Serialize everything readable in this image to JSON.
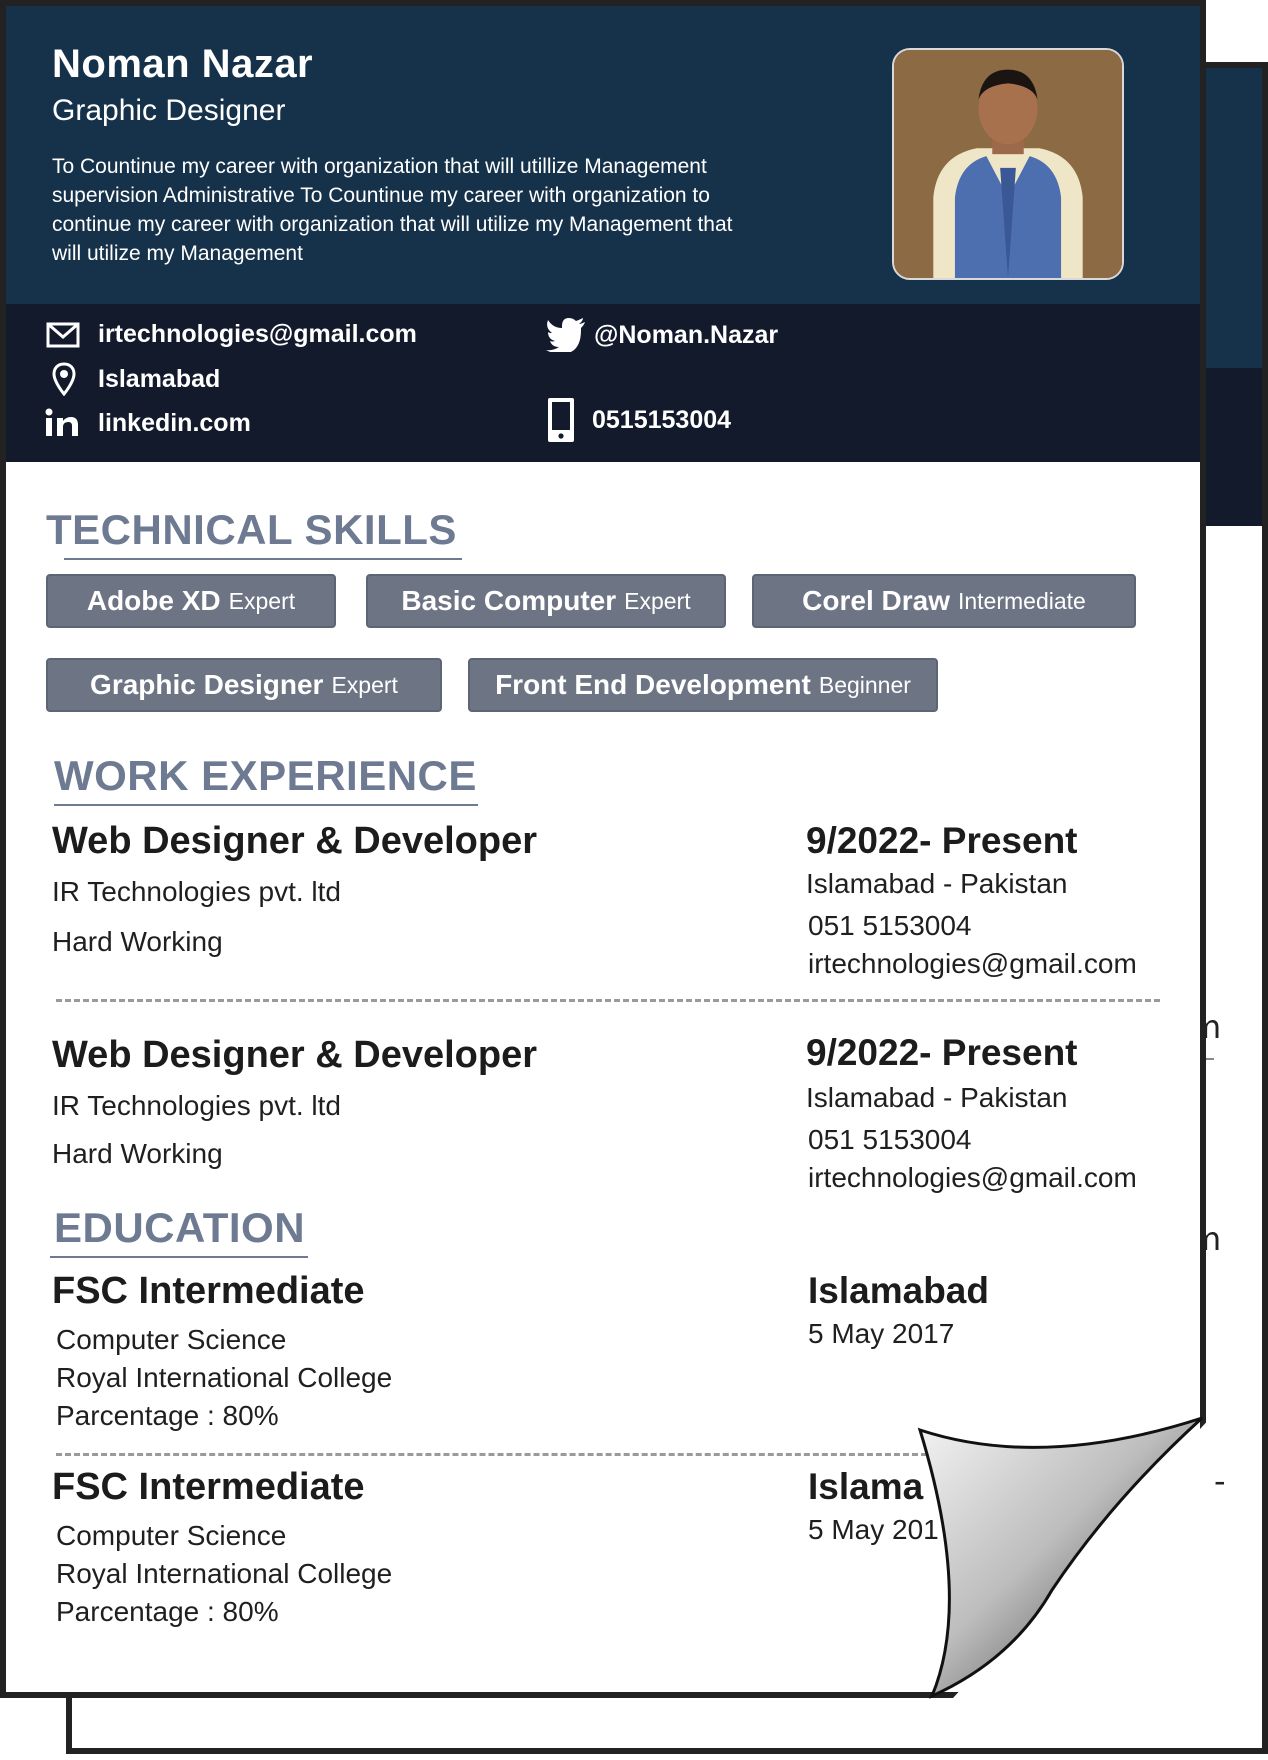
{
  "profile": {
    "name": "Noman Nazar",
    "title": "Graphic Designer",
    "summary": "To Countinue my career with organization that will utillize Management supervision Administrative To Countinue my career with organization to continue my career with organization that will utilize my Management that will utilize my Management"
  },
  "contact": {
    "email": "irtechnologies@gmail.com",
    "location": "Islamabad",
    "linkedin": "linkedin.com",
    "twitter": "@Noman.Nazar",
    "phone": "0515153004"
  },
  "skills": {
    "heading": "TECHNICAL SKILLS",
    "items": [
      {
        "name": "Adobe XD",
        "level": "Expert"
      },
      {
        "name": "Basic Computer",
        "level": "Expert"
      },
      {
        "name": "Corel Draw",
        "level": "Intermediate"
      },
      {
        "name": "Graphic Designer",
        "level": "Expert"
      },
      {
        "name": "Front End Development",
        "level": "Beginner"
      }
    ]
  },
  "experience": {
    "heading": "WORK EXPERIENCE",
    "items": [
      {
        "role": "Web Designer & Developer",
        "company": "IR Technologies pvt. ltd",
        "note": "Hard Working",
        "period": "9/2022- Present",
        "location": "Islamabad - Pakistan",
        "phone": "051 5153004",
        "email": "irtechnologies@gmail.com"
      },
      {
        "role": "Web Designer & Developer",
        "company": "IR Technologies pvt. ltd",
        "note": "Hard Working",
        "period": "9/2022- Present",
        "location": "Islamabad - Pakistan",
        "phone": "051 5153004",
        "email": "irtechnologies@gmail.com"
      }
    ]
  },
  "education": {
    "heading": "EDUCATION",
    "items": [
      {
        "degree": "FSC Intermediate",
        "field": "Computer Science",
        "institute": "Royal International College",
        "score": "Parcentage : 80%",
        "city": "Islamabad",
        "date": "5 May 2017"
      },
      {
        "degree": "FSC Intermediate",
        "field": "Computer Science",
        "institute": "Royal International College",
        "score": "Parcentage : 80%",
        "city": "Islama",
        "date": "5 May 201"
      }
    ]
  },
  "back_page": {
    "fragments": [
      "m",
      "m",
      "-"
    ]
  },
  "colors": {
    "header": "#16324a",
    "contact_bar": "#131a2c",
    "accent": "#6d7a92",
    "chip": "#6d7484"
  },
  "icons": [
    "mail-icon",
    "location-pin-icon",
    "linkedin-icon",
    "twitter-icon",
    "phone-icon"
  ]
}
